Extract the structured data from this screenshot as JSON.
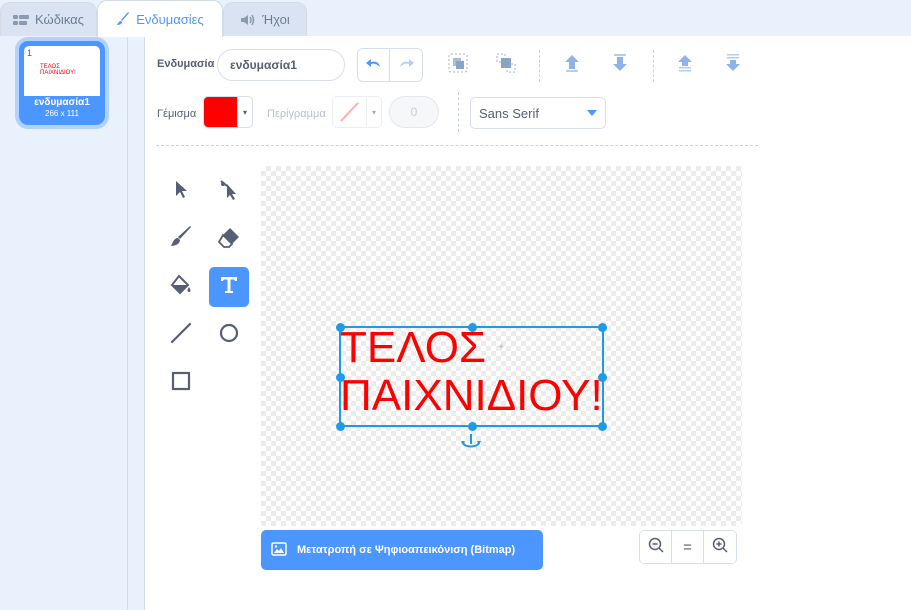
{
  "tabs": [
    {
      "label": "Κώδικας",
      "icon": "code-icon",
      "active": false
    },
    {
      "label": "Ενδυμασίες",
      "icon": "brush-icon",
      "active": true
    },
    {
      "label": "Ήχοι",
      "icon": "speaker-icon",
      "active": false
    }
  ],
  "costumes": [
    {
      "number": "1",
      "name": "ενδυμασία1",
      "size": "266 x 111",
      "thumb_line1": "ΤΕΛΟΣ",
      "thumb_line2": "ΠΑΙΧΝΙΔΙΟΥ!",
      "selected": true
    }
  ],
  "toolbar": {
    "costume_label": "Ενδυμασία",
    "costume_name": "ενδυμασία1",
    "fill_label": "Γέμισμα",
    "fill_color": "#ff0000",
    "outline_label": "Περίγραμμα",
    "outline_width": "0",
    "font": "Sans Serif"
  },
  "canvas": {
    "text_line1": "ΤΕΛΟΣ",
    "text_line2": "ΠΑΙΧΝΙΔΙΟΥ!",
    "text_color": "#ff0000",
    "selection_color": "#1e9be6"
  },
  "tools": [
    "select-tool",
    "reshape-tool",
    "brush-tool",
    "eraser-tool",
    "fill-tool",
    "text-tool",
    "line-tool",
    "circle-tool",
    "rectangle-tool"
  ],
  "active_tool": "text-tool",
  "convert_button": "Μετατροπή σε Ψηφιοαπεικόνιση (Bitmap)",
  "zoom": {
    "out": "−",
    "reset": "=",
    "in": "+"
  },
  "colors": {
    "accent": "#4c97ff",
    "text": "#575e75",
    "background": "#e9f1fc"
  }
}
